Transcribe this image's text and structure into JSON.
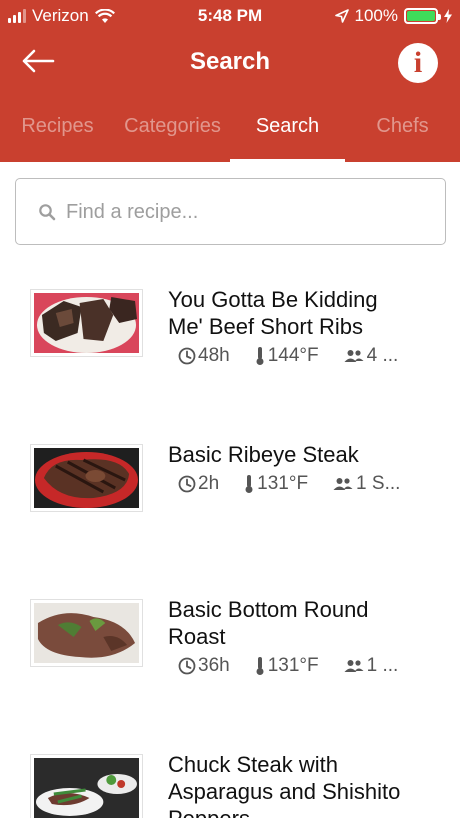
{
  "status_bar": {
    "carrier": "Verizon",
    "time": "5:48 PM",
    "battery": "100%"
  },
  "header": {
    "title": "Search",
    "back_icon": "arrow-left-icon",
    "info_icon": "info-icon"
  },
  "tabs": [
    {
      "label": "Recipes",
      "active": false
    },
    {
      "label": "Categories",
      "active": false
    },
    {
      "label": "Search",
      "active": true
    },
    {
      "label": "Chefs",
      "active": false
    }
  ],
  "search": {
    "placeholder": "Find a recipe...",
    "value": ""
  },
  "recipes": [
    {
      "title_line1": "You Gotta Be Kidding",
      "title_line2": "Me' Beef Short Ribs",
      "time": "48h",
      "temp": "144°F",
      "servings": "4 ..."
    },
    {
      "title_line1": "Basic Ribeye Steak",
      "title_line2": "",
      "time": "2h",
      "temp": "131°F",
      "servings": "1 S..."
    },
    {
      "title_line1": "Basic Bottom Round",
      "title_line2": "Roast",
      "time": "36h",
      "temp": "131°F",
      "servings": "1 ..."
    },
    {
      "title_line1": "Chuck Steak with",
      "title_line2": "Asparagus and Shishito",
      "title_line3": "Peppers"
    }
  ],
  "colors": {
    "brand": "#c9402f",
    "battery": "#3fdc5a"
  }
}
